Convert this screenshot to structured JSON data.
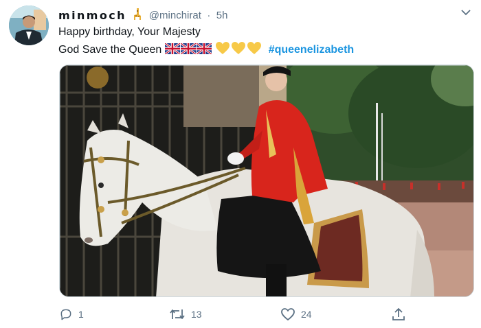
{
  "tweet": {
    "display_name": "minmoch",
    "name_emoji_icon": "giraffe-icon",
    "handle": "@minchirat",
    "separator": "·",
    "time": "5h",
    "line1": "Happy birthday, Your Majesty",
    "line2_text": "God Save the Queen",
    "line2_flags": [
      "uk-flag-icon",
      "uk-flag-icon",
      "uk-flag-icon"
    ],
    "line2_hearts": [
      "yellow-heart-icon",
      "yellow-heart-icon",
      "yellow-heart-icon"
    ],
    "hashtag": "#queenelizabeth"
  },
  "actions": {
    "reply_count": "1",
    "retweet_count": "13",
    "like_count": "24"
  },
  "colors": {
    "text": "#0f1419",
    "secondary": "#5b7083",
    "link": "#1b95e0",
    "heart": "#f7c948",
    "uniform_red": "#d8251c"
  }
}
